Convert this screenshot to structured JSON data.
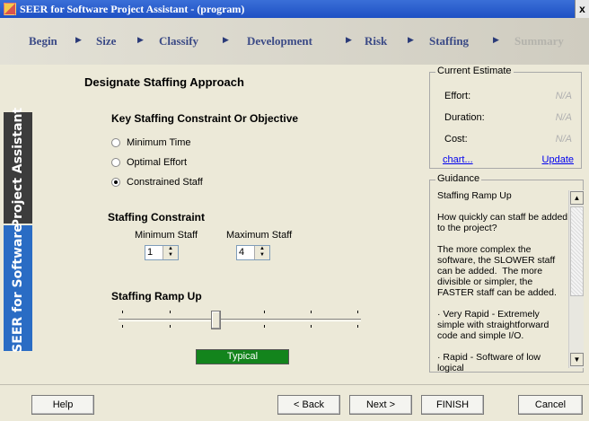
{
  "window": {
    "title": "SEER for Software Project Assistant - (program)",
    "close_label": "x"
  },
  "nav": {
    "steps": [
      {
        "label": "Begin",
        "enabled": true
      },
      {
        "label": "Size",
        "enabled": true
      },
      {
        "label": "Classify",
        "enabled": true
      },
      {
        "label": "Development",
        "enabled": true
      },
      {
        "label": "Risk",
        "enabled": true
      },
      {
        "label": "Staffing",
        "enabled": true
      },
      {
        "label": "Summary",
        "enabled": false
      }
    ]
  },
  "side_tabs": {
    "project_assistant": "Project Assistant",
    "seer": "SEER for Software"
  },
  "main": {
    "page_title": "Designate Staffing Approach",
    "constraint_heading": "Key Staffing Constraint Or Objective",
    "options": [
      {
        "label": "Minimum Time",
        "selected": false
      },
      {
        "label": "Optimal Effort",
        "selected": false
      },
      {
        "label": "Constrained Staff",
        "selected": true
      }
    ],
    "staffing_constraint_heading": "Staffing Constraint",
    "min_staff_label": "Minimum Staff",
    "min_staff_value": "1",
    "max_staff_label": "Maximum Staff",
    "max_staff_value": "4",
    "ramp_heading": "Staffing Ramp Up",
    "ramp_status": "Typical",
    "ramp_level_fraction": 0.43
  },
  "estimate": {
    "title": "Current Estimate",
    "effort_label": "Effort:",
    "effort_value": "N/A",
    "duration_label": "Duration:",
    "duration_value": "N/A",
    "cost_label": "Cost:",
    "cost_value": "N/A",
    "chart_link": "chart...",
    "update_link": "Update"
  },
  "guidance": {
    "title": "Guidance",
    "text": "Staffing Ramp Up\n\nHow quickly can staff be added to the project?\n\nThe more complex the software, the SLOWER staff can be added.  The more divisible or simpler, the FASTER staff can be added.\n\n· Very Rapid - Extremely simple with straightforward code and simple I/O.\n\n· Rapid - Software of low logical"
  },
  "buttons": {
    "help": "Help",
    "back": "< Back",
    "next": "Next >",
    "finish": "FINISH",
    "cancel": "Cancel"
  },
  "colors": {
    "status_green": "#13841c",
    "nav_text": "#3b4a86",
    "seer_tab": "#2a6cc4"
  }
}
